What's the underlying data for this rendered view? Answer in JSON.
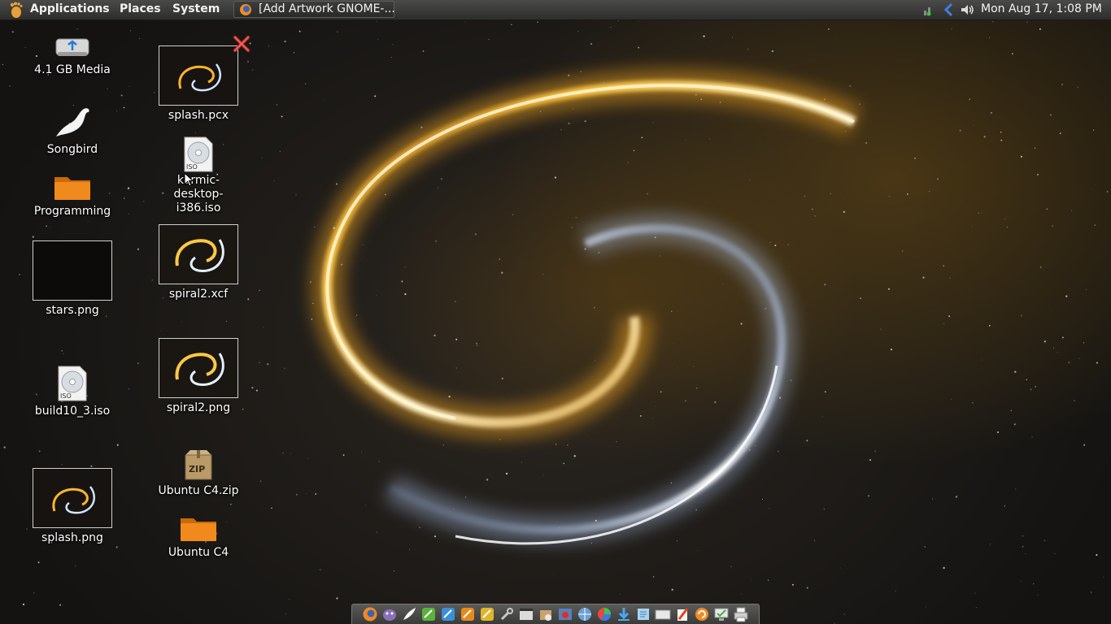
{
  "top_panel": {
    "menus": [
      "Applications",
      "Places",
      "System"
    ],
    "task_title": "[Add Artwork GNOME-...",
    "clock": "Mon Aug 17,  1:08 PM",
    "tray_icons": [
      "network-icon",
      "bluetooth-icon",
      "volume-icon"
    ]
  },
  "desktop": {
    "icons_col1": [
      {
        "name": "4.1 GB Media",
        "icon": "drive-icon"
      },
      {
        "name": "Songbird",
        "icon": "songbird-bird-icon"
      },
      {
        "name": "Programming",
        "icon": "folder-icon"
      },
      {
        "name": "stars.png",
        "icon": "image-thumbnail"
      },
      {
        "name": "build10_3.iso",
        "icon": "disc-image-icon"
      },
      {
        "name": "splash.png",
        "icon": "image-thumbnail"
      }
    ],
    "icons_col2": [
      {
        "name": "splash.pcx",
        "icon": "image-thumbnail"
      },
      {
        "name": "karmic-desktop-i386.iso",
        "line1": "karmic-desktop-",
        "line2": "i386.iso",
        "icon": "disc-image-icon"
      },
      {
        "name": "spiral2.xcf",
        "icon": "image-thumbnail"
      },
      {
        "name": "spiral2.png",
        "icon": "image-thumbnail"
      },
      {
        "name": "Ubuntu C4.zip",
        "icon": "zip-archive-icon"
      },
      {
        "name": "Ubuntu C4",
        "icon": "folder-icon"
      }
    ],
    "iso_badge": "ISO",
    "zip_badge": "ZIP"
  },
  "dock": {
    "items": [
      "firefox-icon",
      "pidgin-icon",
      "inkscape-icon",
      "app-icon-green",
      "app-icon-blue",
      "app-icon-orange",
      "app-icon-yellow",
      "tools-icon",
      "video-icon",
      "package-icon",
      "remove-icon",
      "web-icon",
      "color-wheel-icon",
      "download-icon",
      "notes-icon",
      "keyboard-icon",
      "paint-icon",
      "update-icon",
      "monitor-icon",
      "printer-icon"
    ]
  },
  "colors": {
    "panel": "#2d2d2c",
    "folder": "#e88b1a",
    "spiral_gold": "#ffb52a",
    "spiral_blue": "#cfe6ff"
  }
}
